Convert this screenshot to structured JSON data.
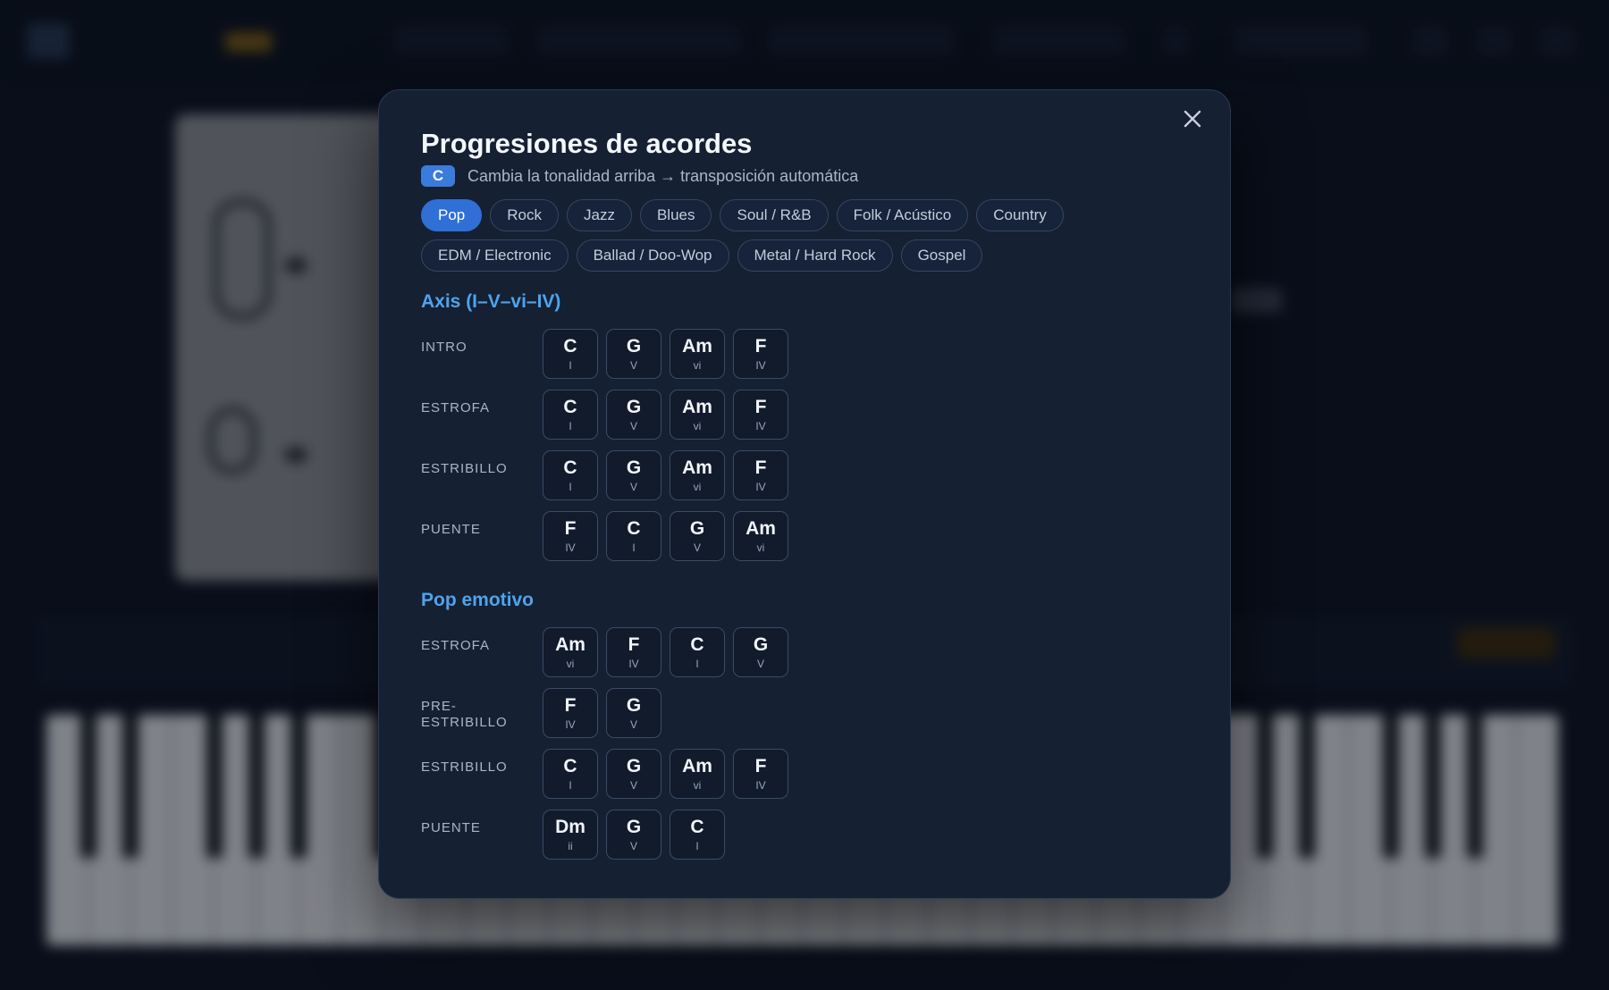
{
  "modal": {
    "title": "Progresiones de acordes",
    "key": "C",
    "hint": "Cambia la tonalidad arriba → transposición automática",
    "close_icon": "close-icon"
  },
  "genres": [
    "Pop",
    "Rock",
    "Jazz",
    "Blues",
    "Soul / R&B",
    "Folk / Acústico",
    "Country",
    "EDM / Electronic",
    "Ballad / Doo-Wop",
    "Metal / Hard Rock",
    "Gospel"
  ],
  "active_genre": "Pop",
  "progressions": [
    {
      "title": "Axis (I–V–vi–IV)",
      "sections": [
        {
          "label": "INTRO",
          "chords": [
            {
              "name": "C",
              "degree": "I"
            },
            {
              "name": "G",
              "degree": "V"
            },
            {
              "name": "Am",
              "degree": "vi"
            },
            {
              "name": "F",
              "degree": "IV"
            }
          ]
        },
        {
          "label": "ESTROFA",
          "chords": [
            {
              "name": "C",
              "degree": "I"
            },
            {
              "name": "G",
              "degree": "V"
            },
            {
              "name": "Am",
              "degree": "vi"
            },
            {
              "name": "F",
              "degree": "IV"
            }
          ]
        },
        {
          "label": "ESTRIBILLO",
          "chords": [
            {
              "name": "C",
              "degree": "I"
            },
            {
              "name": "G",
              "degree": "V"
            },
            {
              "name": "Am",
              "degree": "vi"
            },
            {
              "name": "F",
              "degree": "IV"
            }
          ]
        },
        {
          "label": "PUENTE",
          "chords": [
            {
              "name": "F",
              "degree": "IV"
            },
            {
              "name": "C",
              "degree": "I"
            },
            {
              "name": "G",
              "degree": "V"
            },
            {
              "name": "Am",
              "degree": "vi"
            }
          ]
        }
      ]
    },
    {
      "title": "Pop emotivo",
      "sections": [
        {
          "label": "ESTROFA",
          "chords": [
            {
              "name": "Am",
              "degree": "vi"
            },
            {
              "name": "F",
              "degree": "IV"
            },
            {
              "name": "C",
              "degree": "I"
            },
            {
              "name": "G",
              "degree": "V"
            }
          ]
        },
        {
          "label": "PRE-\nESTRIBILLO",
          "chords": [
            {
              "name": "F",
              "degree": "IV"
            },
            {
              "name": "G",
              "degree": "V"
            }
          ]
        },
        {
          "label": "ESTRIBILLO",
          "chords": [
            {
              "name": "C",
              "degree": "I"
            },
            {
              "name": "G",
              "degree": "V"
            },
            {
              "name": "Am",
              "degree": "vi"
            },
            {
              "name": "F",
              "degree": "IV"
            }
          ]
        },
        {
          "label": "PUENTE",
          "chords": [
            {
              "name": "Dm",
              "degree": "ii"
            },
            {
              "name": "G",
              "degree": "V"
            },
            {
              "name": "C",
              "degree": "I"
            }
          ]
        }
      ]
    }
  ]
}
